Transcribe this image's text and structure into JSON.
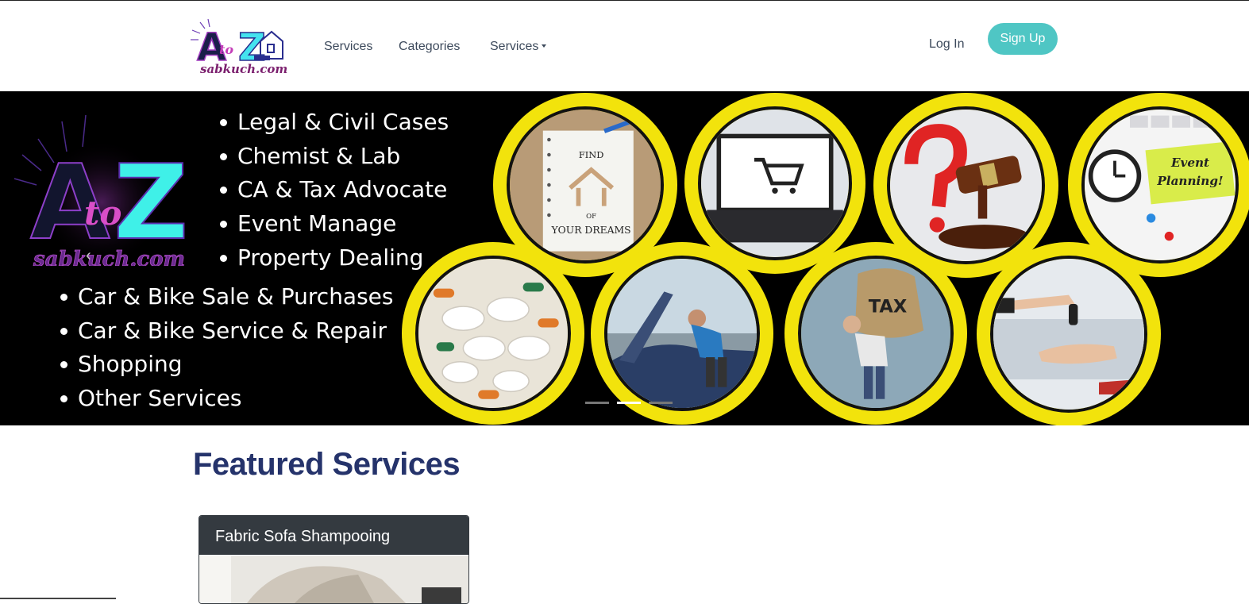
{
  "nav": {
    "logo_text": "sabkuch.com",
    "logo_letters": "AtoZ",
    "links": [
      "Services",
      "Categories",
      "Services"
    ],
    "login": "Log In",
    "signup": "Sign Up"
  },
  "hero": {
    "logo_a": "A",
    "logo_to": "to",
    "logo_z": "Z",
    "logo_text": "sabkuch.com",
    "services_top": [
      "Legal & Civil Cases",
      "Chemist & Lab",
      "CA & Tax Advocate",
      "Event Manage",
      "Property Dealing"
    ],
    "services_bottom": [
      "Car & Bike  Sale & Purchases",
      "Car & Bike Service & Repair",
      "Shopping",
      "Other Services"
    ],
    "image_text": {
      "find": "FIND",
      "of": "OF",
      "dreams": "YOUR DREAMS",
      "tax": "TAX",
      "event": "Event",
      "planning": "Planning!"
    },
    "slide_count": 3,
    "active_slide": 2
  },
  "featured": {
    "title": "Featured Services",
    "cards": [
      {
        "title": "Fabric Sofa Shampooing"
      }
    ]
  },
  "colors": {
    "accent": "#4fc6c4",
    "heading": "#25336b",
    "ring": "#f2e30c",
    "card_header": "#343a40"
  }
}
